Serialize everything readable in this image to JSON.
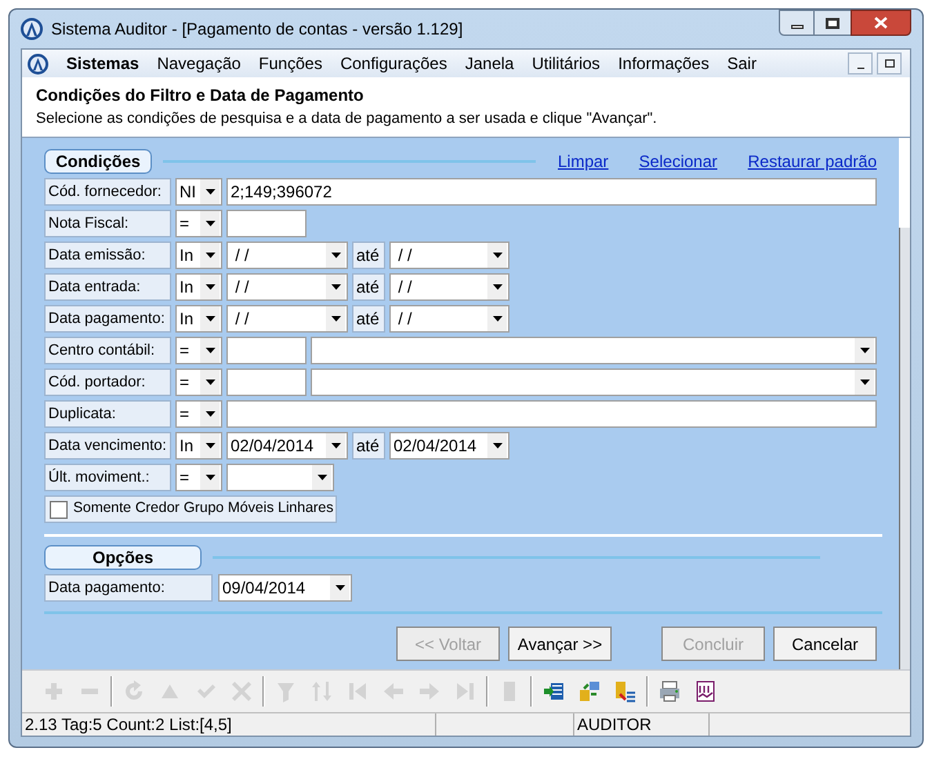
{
  "window": {
    "title": "Sistema Auditor - [Pagamento de contas - versão 1.129]"
  },
  "menu": [
    {
      "label": "Sistemas",
      "bold": true
    },
    {
      "label": "Navegação",
      "bold": false
    },
    {
      "label": "Funções",
      "bold": false
    },
    {
      "label": "Configurações",
      "bold": false
    },
    {
      "label": "Janela",
      "bold": false
    },
    {
      "label": "Utilitários",
      "bold": false
    },
    {
      "label": "Informações",
      "bold": false
    },
    {
      "label": "Sair",
      "bold": false
    }
  ],
  "header": {
    "title": "Condições do Filtro e Data de Pagamento",
    "subtitle": "Selecione as condições de pesquisa e a data de pagamento a ser usada e clique \"Avançar\"."
  },
  "conditions": {
    "title": "Condições",
    "links": [
      "Limpar",
      "Selecionar",
      "Restaurar padrão"
    ],
    "rows": [
      {
        "kind": "text",
        "label": "Cód. fornecedor:",
        "operator": "NI",
        "value": "2;149;396072"
      },
      {
        "kind": "short",
        "label": "Nota Fiscal:",
        "operator": "="
      },
      {
        "kind": "range",
        "label": "Data emissão:",
        "operator": "In",
        "from": " / /",
        "until": "até",
        "to": " / /"
      },
      {
        "kind": "range",
        "label": "Data entrada:",
        "operator": "In",
        "from": " / /",
        "until": "até",
        "to": " / /"
      },
      {
        "kind": "range",
        "label": "Data pagamento:",
        "operator": "In",
        "from": " / /",
        "until": "até",
        "to": " / /"
      },
      {
        "kind": "code",
        "label": "Centro contábil:",
        "operator": "="
      },
      {
        "kind": "code",
        "label": "Cód. portador:",
        "operator": "="
      },
      {
        "kind": "text",
        "label": "Duplicata:",
        "operator": "="
      },
      {
        "kind": "range",
        "label": "Data vencimento:",
        "operator": "In",
        "from": "02/04/2014",
        "until": "até",
        "to": "02/04/2014"
      },
      {
        "kind": "select",
        "label": "Últ. moviment.:",
        "operator": "="
      }
    ],
    "checkbox": {
      "label": "Somente Credor Grupo Móveis Linhares",
      "checked": false
    }
  },
  "options": {
    "title": "Opções",
    "label": "Data pagamento:",
    "value": "09/04/2014"
  },
  "buttons": [
    {
      "label": "<< Voltar",
      "disabled": true
    },
    {
      "label": "Avançar >>",
      "disabled": false
    },
    {
      "label": "Concluir",
      "disabled": true
    },
    {
      "label": "Cancelar",
      "disabled": false
    }
  ],
  "toolbar": [
    {
      "disabled": true
    },
    {
      "disabled": true
    },
    {
      "disabled": true
    },
    {
      "disabled": true
    },
    {
      "disabled": true
    },
    {
      "disabled": true
    },
    {
      "disabled": true
    },
    {
      "disabled": true
    },
    {
      "disabled": true
    },
    {
      "disabled": true
    },
    {
      "disabled": true
    },
    {
      "disabled": true
    },
    {
      "disabled": true
    },
    {
      "disabled": false
    },
    {
      "disabled": false
    },
    {
      "disabled": false
    },
    {
      "disabled": false
    },
    {
      "disabled": false
    }
  ],
  "status_bar": {
    "info": "2.13 Tag:5 Count:2 List:[4,5]",
    "user": "AUDITOR"
  }
}
